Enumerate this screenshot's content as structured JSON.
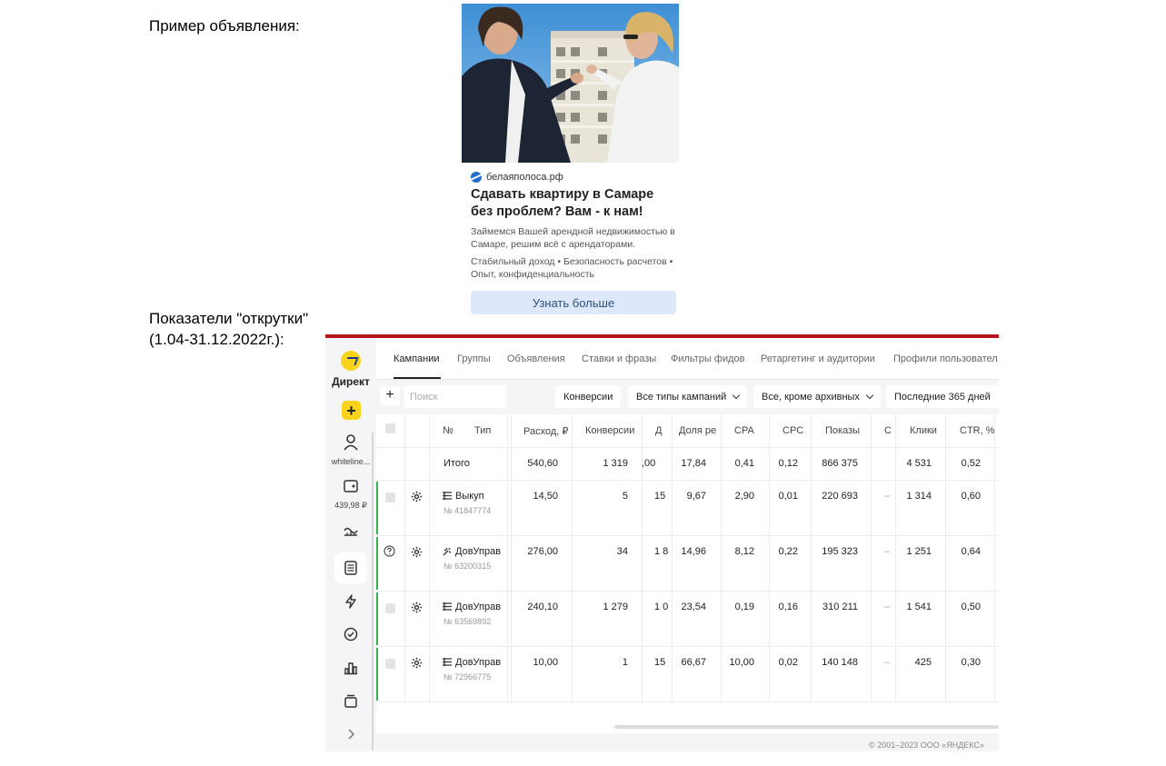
{
  "document": {
    "ad_example_label": "Пример объявления:",
    "metrics_label_line1": "Показатели \"открутки\"",
    "metrics_label_line2": "(1.04-31.12.2022г.):"
  },
  "ad": {
    "domain": "белаяполоса.рф",
    "title": "Сдавать квартиру в Самаре без проблем? Вам - к нам!",
    "description": "Займемся Вашей арендной недвижимостью в Самаре, решим всё с арендаторами.",
    "features": "Стабильный доход • Безопасность расчетов • Опыт, конфиденциальность",
    "cta": "Узнать больше"
  },
  "sidebar": {
    "logo_text": "Директ",
    "account_name": "whiteline...",
    "balance": "439,98 ₽"
  },
  "tabs": [
    "Кампании",
    "Группы",
    "Объявления",
    "Ставки и фразы",
    "Фильтры фидов",
    "Ретаргетинг и аудитории",
    "Профили пользовател"
  ],
  "toolbar": {
    "search_placeholder": "Поиск",
    "conversions_btn": "Конверсии",
    "campaign_types": "Все типы кампаний",
    "archive_filter": "Все, кроме архивных",
    "period": "Последние 365 дней"
  },
  "table": {
    "headers": {
      "num": "№",
      "type": "Тип",
      "spend": "Расход, ₽",
      "conversions": "Конверсии",
      "d": "Д",
      "share": "Доля ре",
      "cpa": "CPA",
      "cpc": "CPC",
      "impressions": "Показы",
      "c": "С",
      "clicks": "Клики",
      "ctr": "CTR, %"
    },
    "total": {
      "label": "Итого",
      "spend": "540,60",
      "conversions": "1 319",
      "d": ",00",
      "share": "17,84",
      "cpa": "0,41",
      "cpc": "0,12",
      "impressions": "866 375",
      "clicks": "4 531",
      "ctr": "0,52"
    },
    "rows": [
      {
        "name": "Выкуп",
        "id": "№ 41847774",
        "spend": "14,50",
        "conversions": "5",
        "d": "15",
        "share": "9,67",
        "cpa": "2,90",
        "cpc": "0,01",
        "impressions": "220 693",
        "c": "–",
        "clicks": "1 314",
        "ctr": "0,60"
      },
      {
        "name": "ДовУправ",
        "id": "№ 63200315",
        "spend": "276,00",
        "conversions": "34",
        "d": "1 8",
        "share": "14,96",
        "cpa": "8,12",
        "cpc": "0,22",
        "impressions": "195 323",
        "c": "–",
        "clicks": "1 251",
        "ctr": "0,64"
      },
      {
        "name": "ДовУправ",
        "id": "№ 63569892",
        "spend": "240,10",
        "conversions": "1 279",
        "d": "1 0",
        "share": "23,54",
        "cpa": "0,19",
        "cpc": "0,16",
        "impressions": "310 211",
        "c": "–",
        "clicks": "1 541",
        "ctr": "0,50"
      },
      {
        "name": "ДовУправ",
        "id": "№ 72966775",
        "spend": "10,00",
        "conversions": "1",
        "d": "15",
        "share": "66,67",
        "cpa": "10,00",
        "cpc": "0,02",
        "impressions": "140 148",
        "c": "–",
        "clicks": "425",
        "ctr": "0,30"
      }
    ]
  },
  "footer": "© 2001–2023 ООО «ЯНДЕКС»"
}
